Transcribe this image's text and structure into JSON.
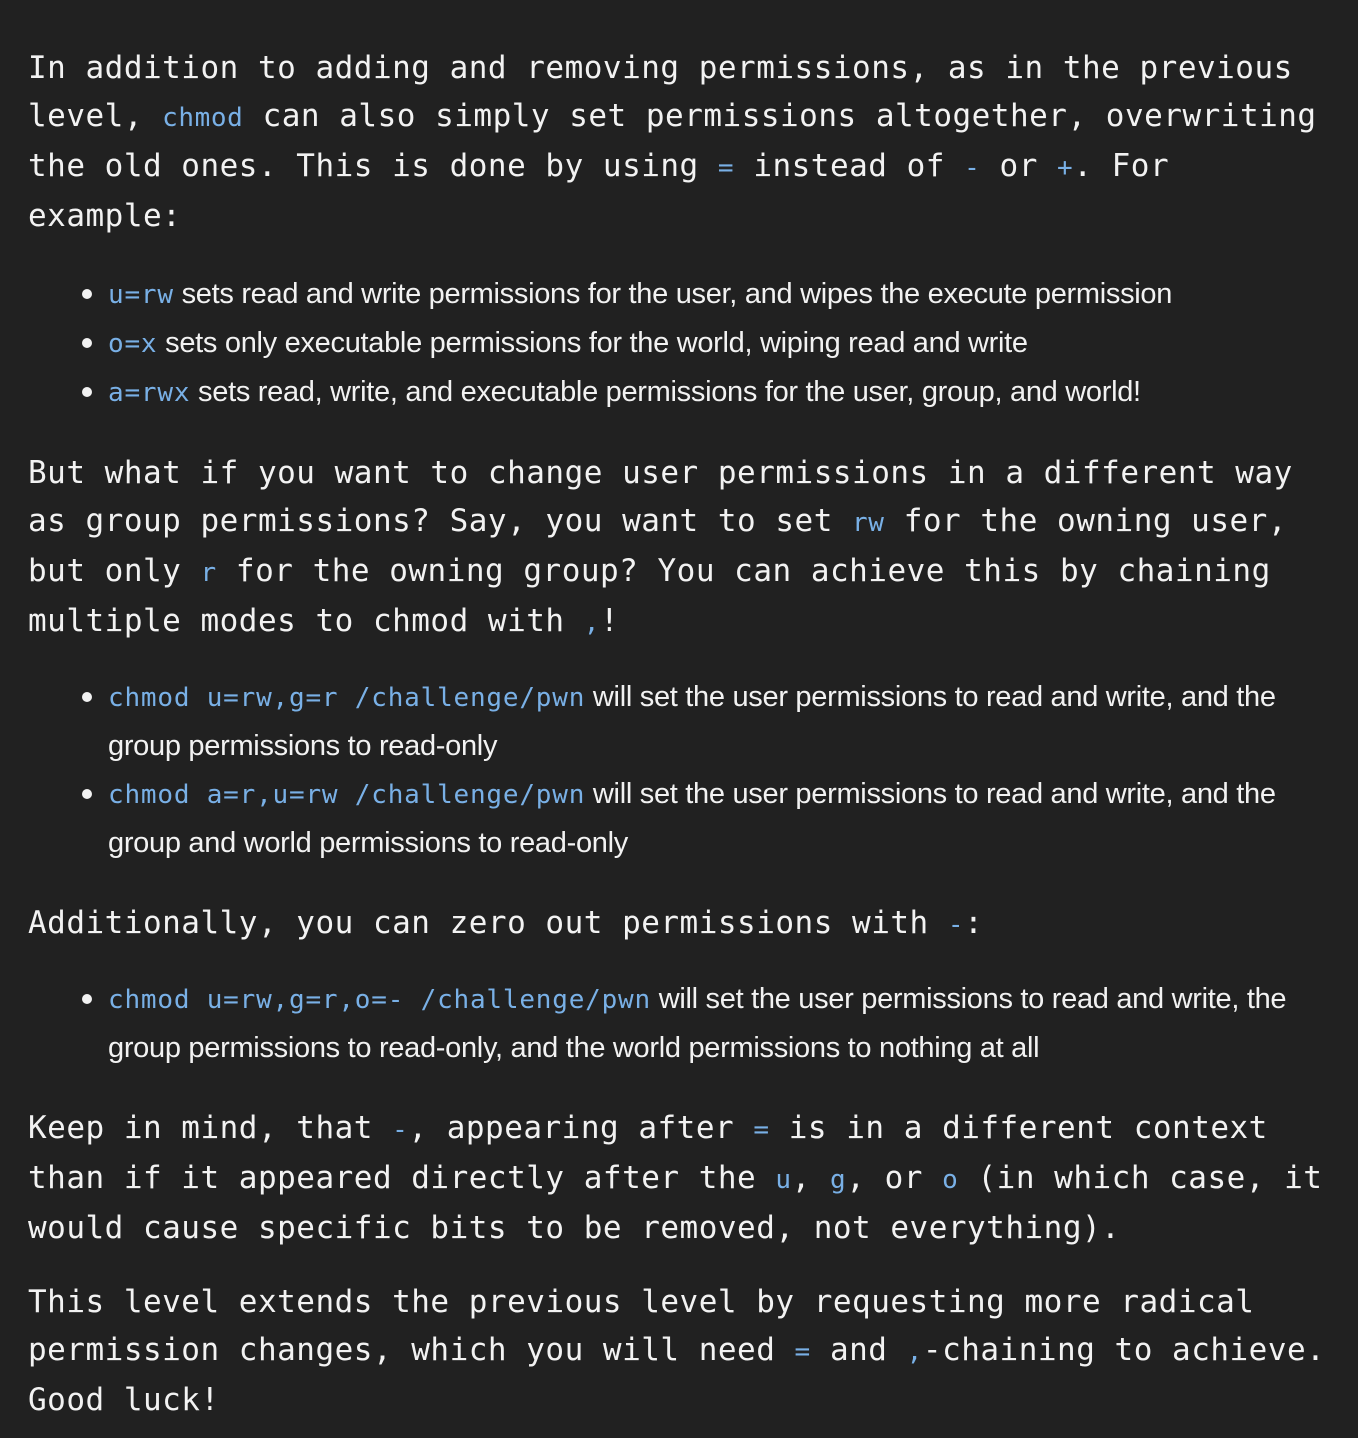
{
  "p1": {
    "t1": "In addition to adding and removing permissions, as in the previous level, ",
    "c1": "chmod",
    "t2": " can also simply set permissions altogether, overwriting the old ones. This is done by using ",
    "c2": "=",
    "t3": " instead of ",
    "c3": "-",
    "t4": " or ",
    "c4": "+",
    "t5": ". For example:"
  },
  "list1": [
    {
      "code": "u=rw",
      "text": " sets read and write permissions for the user, and wipes the execute permission"
    },
    {
      "code": "o=x",
      "text": " sets only executable permissions for the world, wiping read and write"
    },
    {
      "code": "a=rwx",
      "text": " sets read, write, and executable permissions for the user, group, and world!"
    }
  ],
  "p2": {
    "t1": "But what if you want to change user permissions in a different way as group permissions? Say, you want to set ",
    "c1": "rw",
    "t2": " for the owning user, but only ",
    "c2": "r",
    "t3": " for the owning group? You can achieve this by chaining multiple modes to chmod with ",
    "c3": ",",
    "t4": "!"
  },
  "list2": [
    {
      "code": "chmod u=rw,g=r /challenge/pwn",
      "text": " will set the user permissions to read and write, and the group permissions to read-only"
    },
    {
      "code": "chmod a=r,u=rw /challenge/pwn",
      "text": " will set the user permissions to read and write, and the group and world permissions to read-only"
    }
  ],
  "p3": {
    "t1": "Additionally, you can zero out permissions with ",
    "c1": "-",
    "t2": ":"
  },
  "list3": [
    {
      "code": "chmod u=rw,g=r,o=- /challenge/pwn",
      "text": " will set the user permissions to read and write, the group permissions to read-only, and the world permissions to nothing at all"
    }
  ],
  "p4": {
    "t1": "Keep in mind, that ",
    "c1": "-",
    "t2": ", appearing after ",
    "c2": "=",
    "t3": " is in a different context than if it appeared directly after the ",
    "c3": "u",
    "t4": ", ",
    "c4": "g",
    "t5": ", or ",
    "c5": "o",
    "t6": " (in which case, it would cause specific bits to be removed, not everything)."
  },
  "p5": {
    "t1": "This level extends the previous level by requesting more radical permission changes, which you will need ",
    "c1": "=",
    "t2": " and ",
    "c2": ",",
    "t3": "-chaining to achieve. Good luck!"
  },
  "colors": {
    "background": "#212121",
    "text": "#f2f2f2",
    "code": "#79b0e6"
  }
}
